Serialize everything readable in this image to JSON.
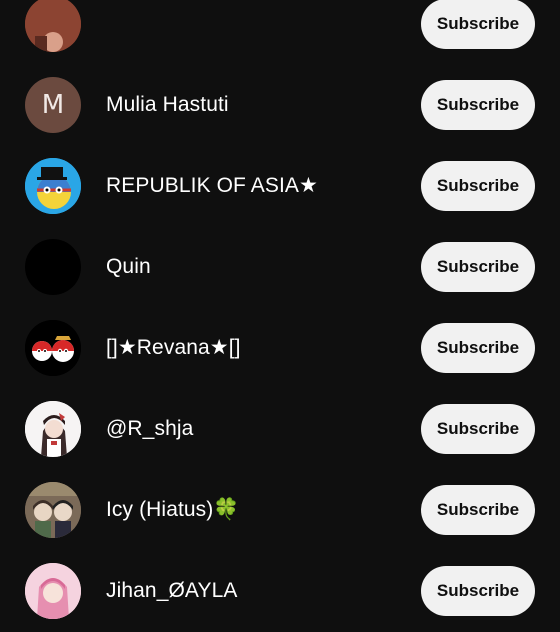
{
  "colors": {
    "background": "#0f0f0f",
    "button_bg": "#f1f1f1",
    "button_text": "#0f0f0f",
    "text": "#ffffff",
    "avatar_m_bg": "#6b4a3f"
  },
  "channels": [
    {
      "name": "",
      "avatar_icon": "partial-avatar-icon",
      "button_label": "Subscribe"
    },
    {
      "name": "Mulia Hastuti",
      "avatar_letter": "M",
      "avatar_icon": "letter-avatar-icon",
      "button_label": "Subscribe"
    },
    {
      "name": "REPUBLIK OF ASIA★",
      "avatar_icon": "countryball-avatar-icon",
      "button_label": "Subscribe"
    },
    {
      "name": "Quin",
      "avatar_icon": "black-avatar-icon",
      "button_label": "Subscribe"
    },
    {
      "name": "[]★Revana★[]",
      "avatar_icon": "countryballs-avatar-icon",
      "button_label": "Subscribe"
    },
    {
      "name": "@R_shja",
      "avatar_icon": "anime-character-avatar-icon",
      "button_label": "Subscribe"
    },
    {
      "name": "Icy (Hiatus)🍀",
      "avatar_icon": "characters-avatar-icon",
      "button_label": "Subscribe"
    },
    {
      "name": "Jihan_ØAYLA",
      "avatar_icon": "anime-girl-avatar-icon",
      "button_label": "Subscribe"
    }
  ]
}
